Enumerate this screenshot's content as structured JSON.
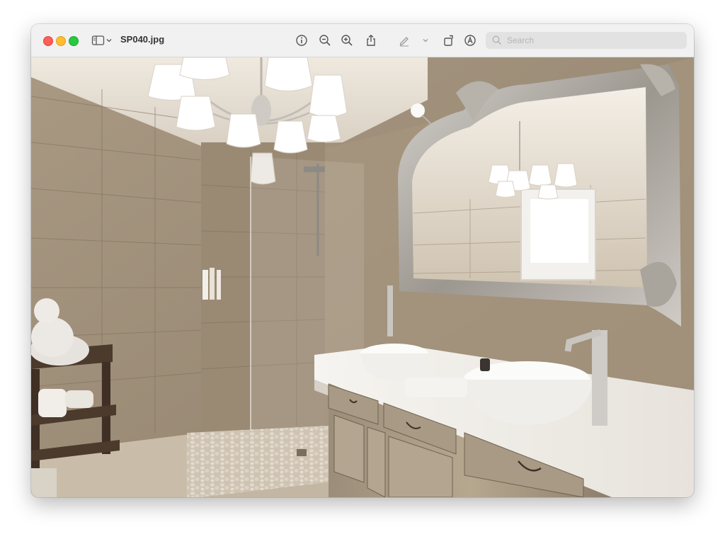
{
  "window": {
    "title": "SP040.jpg"
  },
  "toolbar": {
    "search_placeholder": "Search",
    "icons": [
      "sidebar-icon",
      "info-icon",
      "zoom-out-icon",
      "zoom-in-icon",
      "share-icon",
      "markup-pen-icon",
      "rotate-icon",
      "annotate-icon",
      "search-icon"
    ]
  },
  "colors": {
    "close": "#ff5f57",
    "minimize": "#febc2e",
    "maximize": "#28c840"
  }
}
